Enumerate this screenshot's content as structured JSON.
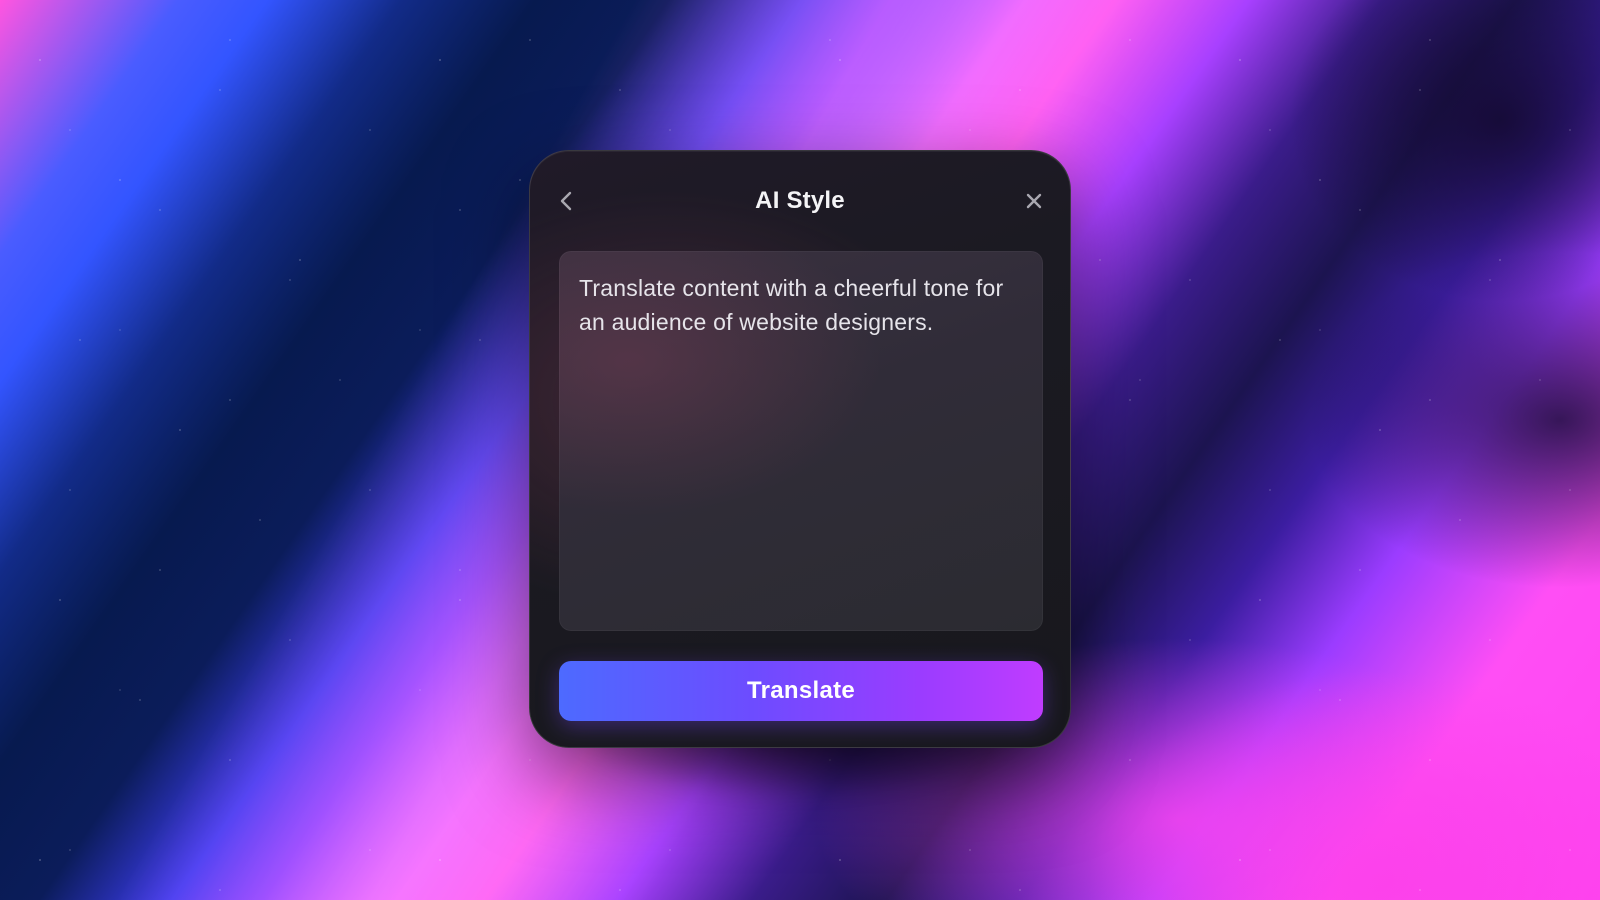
{
  "dialog": {
    "title": "AI Style",
    "back_icon": "chevron-left-icon",
    "close_icon": "close-icon",
    "prompt": {
      "value": "Translate content with a cheerful tone for an audience of website designers."
    },
    "primary_button": {
      "label": "Translate"
    }
  },
  "colors": {
    "button_gradient_start": "#4d6aff",
    "button_gradient_end": "#c03cff",
    "dialog_background": "#1b1a22",
    "textarea_background": "#302c38",
    "title_text": "#f4f4f6"
  }
}
